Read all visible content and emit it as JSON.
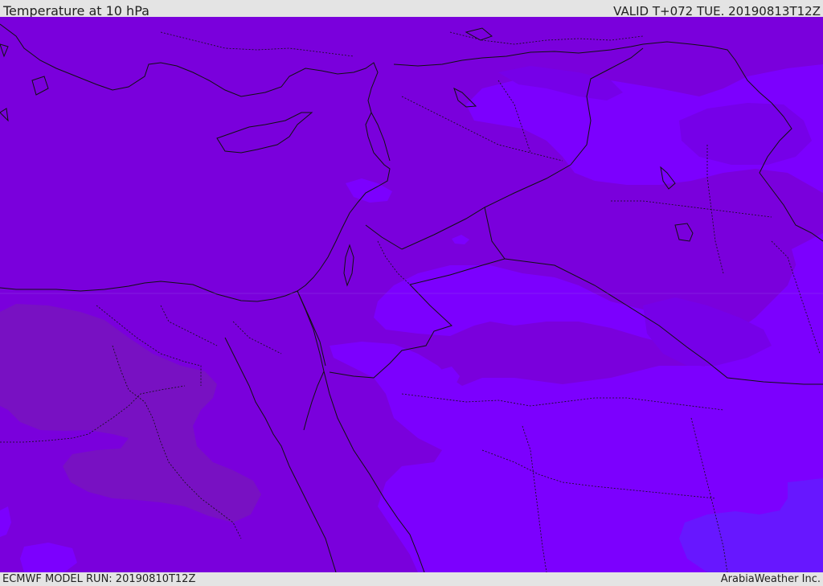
{
  "header": {
    "title": "Temperature at 10 hPa",
    "valid_time": "VALID T+072 TUE. 20190813T12Z"
  },
  "footer": {
    "model_run": "ECMWF MODEL RUN: 20190810T12Z",
    "credit": "ArabiaWeather Inc."
  },
  "colors": {
    "dominant_field": "#7a00dc",
    "warmer_field": "#7811c2",
    "cooler_field": "#7c00fe",
    "coldest_field": "#6717ff",
    "border_line": "#111111",
    "header_background": "#e4e4e4"
  },
  "map": {
    "field": "Temperature",
    "level": "10 hPa",
    "region": "Middle East"
  }
}
